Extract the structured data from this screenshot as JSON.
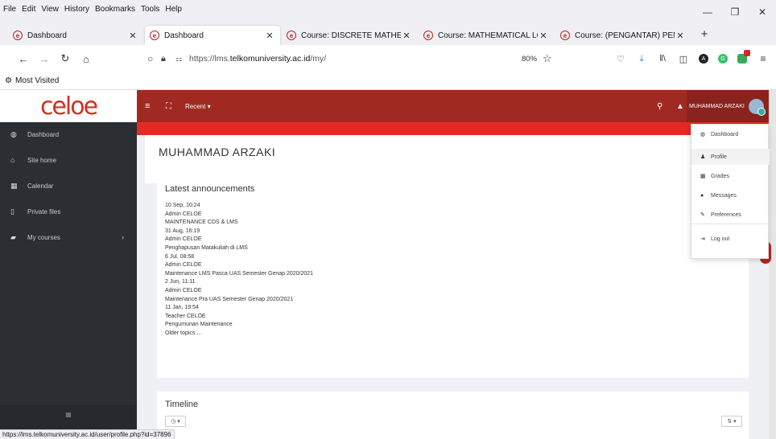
{
  "menubar": [
    "File",
    "Edit",
    "View",
    "History",
    "Bookmarks",
    "Tools",
    "Help"
  ],
  "tabs": [
    {
      "title": "Dashboard",
      "active": false
    },
    {
      "title": "Dashboard",
      "active": true
    },
    {
      "title": "Course: DISCRETE MATHEMATIC",
      "active": false
    },
    {
      "title": "Course: MATHEMATICAL LOGIC",
      "active": false
    },
    {
      "title": "Course: (PENGANTAR) PEMROG",
      "active": false
    }
  ],
  "url": {
    "prefix": "https://lms.",
    "domain": "telkomuniversity.ac.id",
    "path": "/my/"
  },
  "zoom": "80%",
  "bookmarks": {
    "most_visited": "Most Visited"
  },
  "site": {
    "logo": "celoe",
    "recent": "Recent ▾",
    "user": "MUHAMMAD ARZAKI",
    "sidebar": [
      "Dashboard",
      "Site home",
      "Calendar",
      "Private files",
      "My courses"
    ],
    "page_title": "MUHAMMAD ARZAKI",
    "latest_title": "Latest announcements",
    "announcements": [
      "10 Sep, 10:24",
      "Admin CELOE",
      "MAINTENANCE CDS & LMS",
      "31 Aug, 16:19",
      "Admin CELOE",
      "Penghapusan Matakuliah di LMS",
      "6 Jul, 08:58",
      "Admin CELOE",
      "Maintenance LMS Pasca UAS Semester Genap 2020/2021",
      "2 Jun, 11:11",
      "Admin CELOE",
      "Maintenance Pra UAS Semester Genap 2020/2021",
      "11 Jan, 19:54",
      "Teacher CELOE",
      "Pengumunan Maintenance",
      "Older topics ..."
    ],
    "timeline_title": "Timeline",
    "user_menu": [
      "Dashboard",
      "Profile",
      "Grades",
      "Messages",
      "Preferences",
      "Log out"
    ]
  },
  "status_url": "https://lms.telkomuniversity.ac.id/user/profile.php?id=37896"
}
